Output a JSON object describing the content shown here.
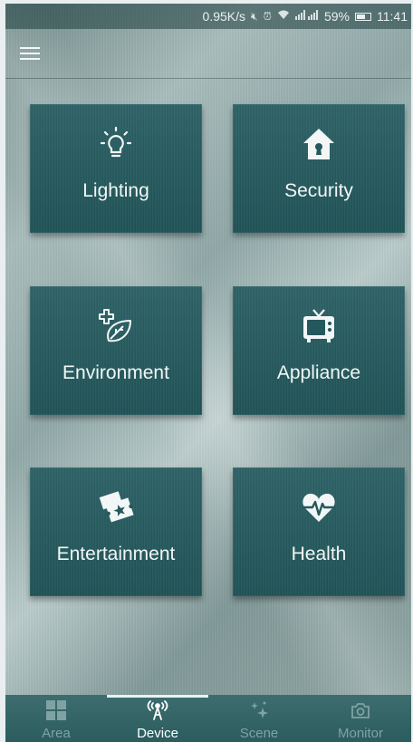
{
  "status_bar": {
    "speed": "0.95K/s",
    "battery_percent": "59%",
    "time": "11:41"
  },
  "header": {
    "menu_icon": "hamburger-menu-icon"
  },
  "categories": [
    {
      "label": "Lighting",
      "icon": "light-bulb-icon"
    },
    {
      "label": "Security",
      "icon": "home-lock-icon"
    },
    {
      "label": "Environment",
      "icon": "leaf-plus-icon"
    },
    {
      "label": "Appliance",
      "icon": "tv-icon"
    },
    {
      "label": "Entertainment",
      "icon": "ticket-icon"
    },
    {
      "label": "Health",
      "icon": "heartbeat-icon"
    }
  ],
  "bottom_nav": {
    "active": "Device",
    "items": [
      {
        "label": "Area",
        "icon": "grid-icon"
      },
      {
        "label": "Device",
        "icon": "antenna-icon"
      },
      {
        "label": "Scene",
        "icon": "sparkle-icon"
      },
      {
        "label": "Monitor",
        "icon": "camera-icon"
      }
    ]
  },
  "colors": {
    "tile": "#285c60",
    "nav_bg": "#346466",
    "nav_inactive": "#7fa3a3",
    "nav_active": "#ffffff"
  }
}
